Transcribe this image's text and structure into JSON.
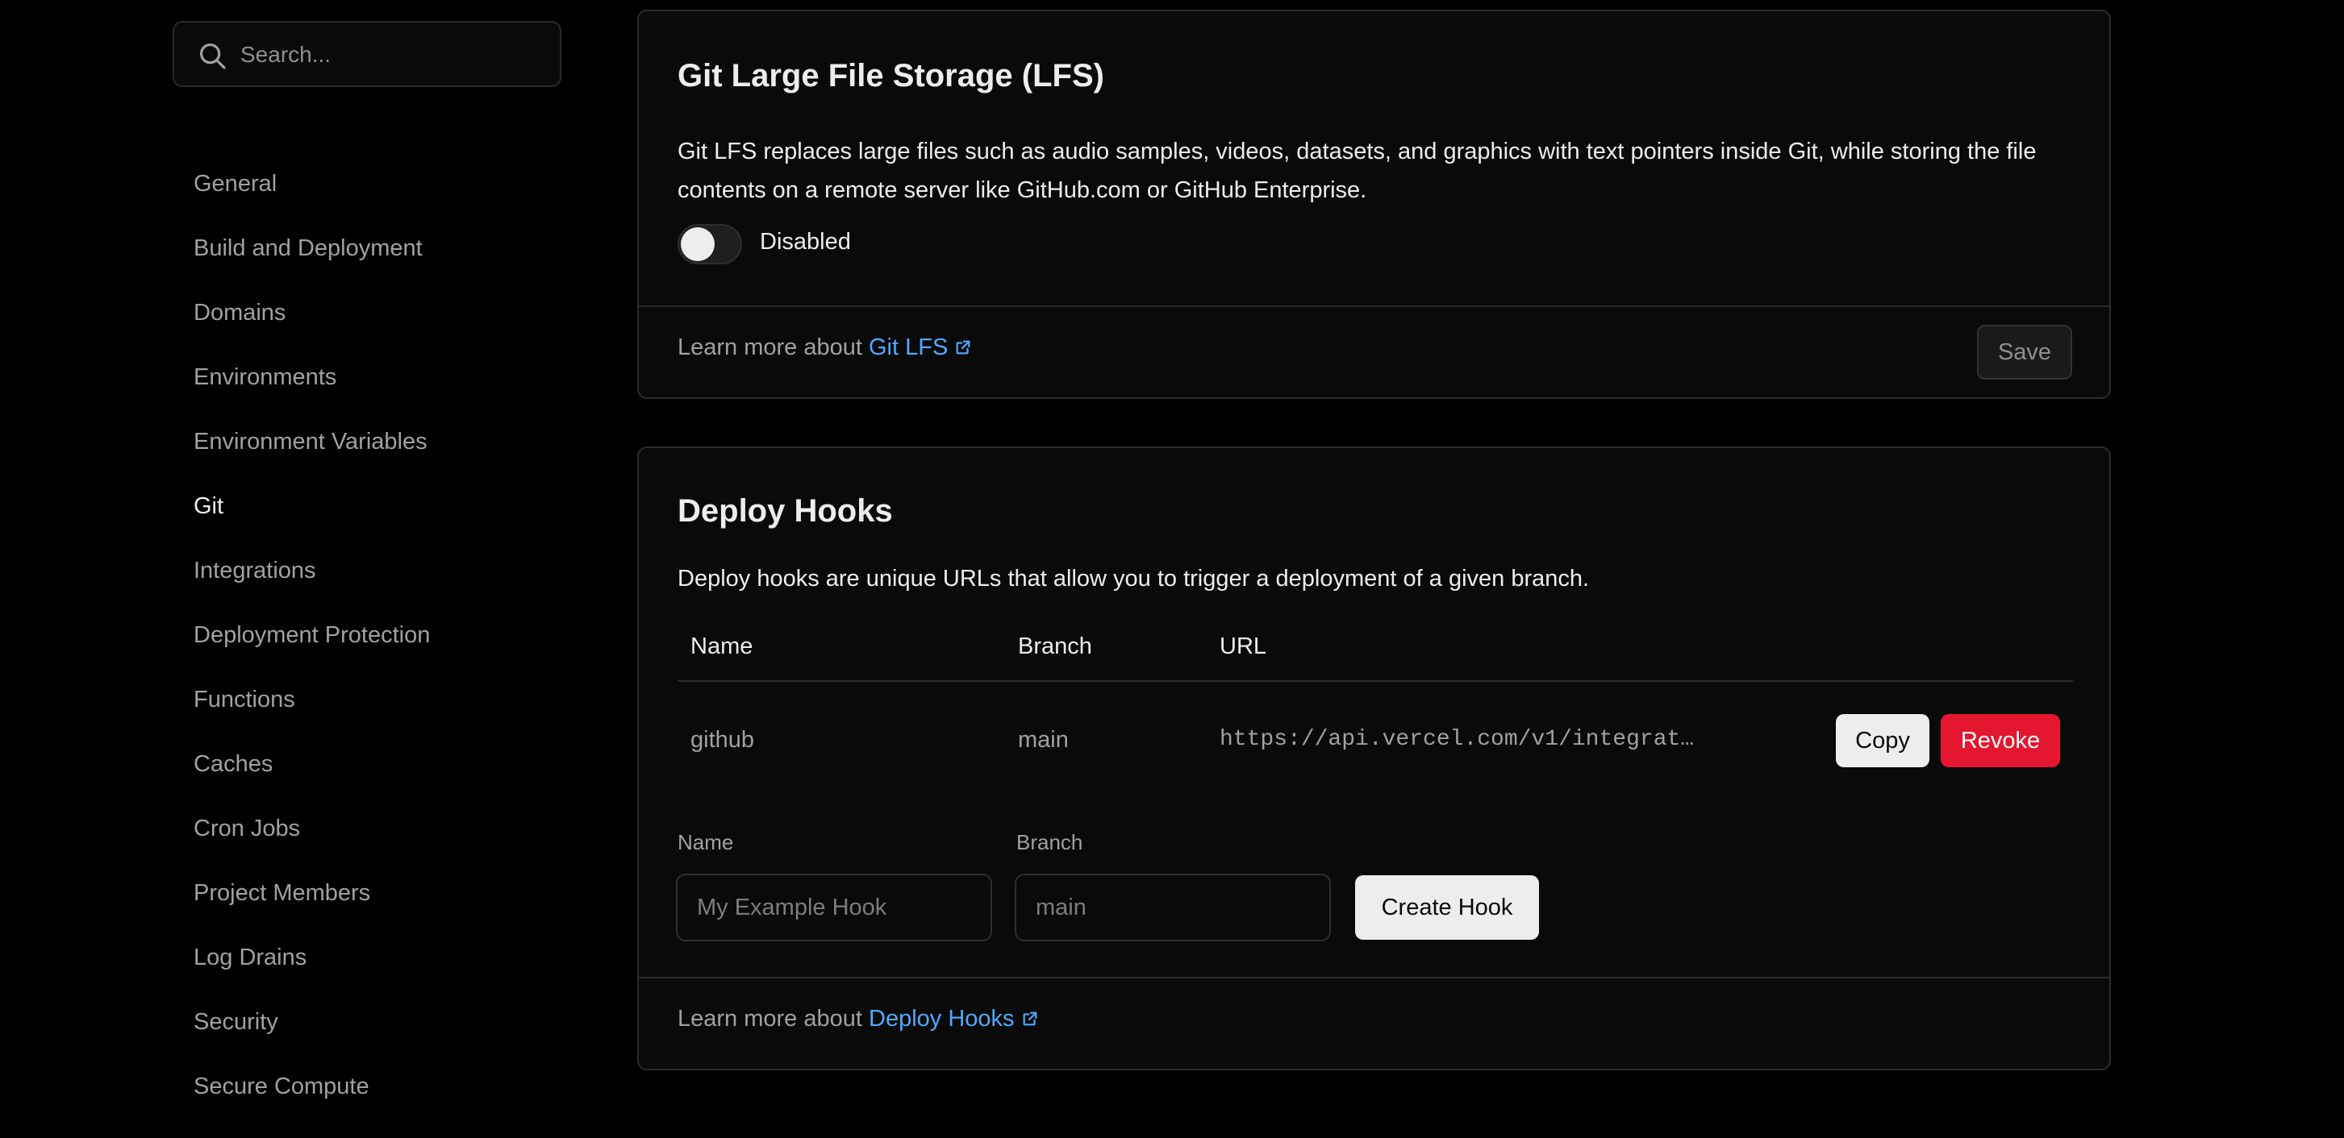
{
  "search": {
    "placeholder": "Search..."
  },
  "sidebar": {
    "items": [
      {
        "label": "General"
      },
      {
        "label": "Build and Deployment"
      },
      {
        "label": "Domains"
      },
      {
        "label": "Environments"
      },
      {
        "label": "Environment Variables"
      },
      {
        "label": "Git",
        "active": true
      },
      {
        "label": "Integrations"
      },
      {
        "label": "Deployment Protection"
      },
      {
        "label": "Functions"
      },
      {
        "label": "Caches"
      },
      {
        "label": "Cron Jobs"
      },
      {
        "label": "Project Members"
      },
      {
        "label": "Log Drains"
      },
      {
        "label": "Security"
      },
      {
        "label": "Secure Compute"
      }
    ]
  },
  "lfs": {
    "title": "Git Large File Storage (LFS)",
    "description_line1": "Git LFS replaces large files such as audio samples, videos, datasets, and graphics with text pointers inside Git, while storing the file",
    "description_line2": "contents on a remote server like GitHub.com or GitHub Enterprise.",
    "toggle_label": "Disabled",
    "toggle_on": false,
    "learn_prefix": "Learn more about",
    "learn_link": "Git LFS",
    "save_label": "Save"
  },
  "deploy_hooks": {
    "title": "Deploy Hooks",
    "description": "Deploy hooks are unique URLs that allow you to trigger a deployment of a given branch.",
    "columns": {
      "name": "Name",
      "branch": "Branch",
      "url": "URL"
    },
    "rows": [
      {
        "name": "github",
        "branch": "main",
        "url": "https://api.vercel.com/v1/integrat…"
      }
    ],
    "copy_label": "Copy",
    "revoke_label": "Revoke",
    "form": {
      "name_label": "Name",
      "name_placeholder": "My Example Hook",
      "branch_label": "Branch",
      "branch_placeholder": "main",
      "create_label": "Create Hook"
    },
    "learn_prefix": "Learn more about",
    "learn_link": "Deploy Hooks"
  },
  "colors": {
    "background": "#000000",
    "card": "#0a0a0a",
    "border": "#2b2b2b",
    "link": "#52a8ff",
    "danger": "#e5162f"
  }
}
